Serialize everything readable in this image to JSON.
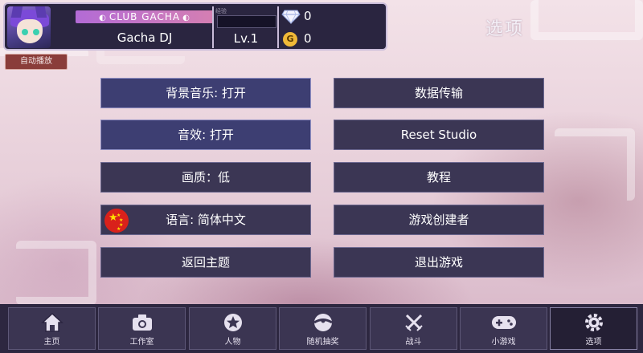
{
  "header": {
    "club_name": "CLUB GACHA",
    "player_name": "Gacha DJ",
    "level": "Lv.1",
    "xp_label": "经验",
    "gems": "0",
    "gold": "0",
    "gold_symbol": "G"
  },
  "page_title": "选项",
  "small_button": "自动播放",
  "menu": {
    "left": [
      {
        "label": "背景音乐: 打开",
        "state": "on"
      },
      {
        "label": "音效: 打开",
        "state": "on"
      },
      {
        "label": "画质：低"
      },
      {
        "label": "语言: 简体中文"
      },
      {
        "label": "返回主题"
      }
    ],
    "right": [
      {
        "label": "数据传输"
      },
      {
        "label": "Reset Studio"
      },
      {
        "label": "教程"
      },
      {
        "label": "游戏创建者"
      },
      {
        "label": "退出游戏"
      }
    ]
  },
  "nav": [
    {
      "label": "主页",
      "icon": "home-icon"
    },
    {
      "label": "工作室",
      "icon": "camera-icon"
    },
    {
      "label": "人物",
      "icon": "star-icon"
    },
    {
      "label": "随机抽奖",
      "icon": "gacha-ball-icon"
    },
    {
      "label": "战斗",
      "icon": "crossed-swords-icon"
    },
    {
      "label": "小游戏",
      "icon": "gamepad-icon"
    },
    {
      "label": "选项",
      "icon": "gear-icon",
      "active": true
    }
  ],
  "colors": {
    "panel": "#3b3654",
    "panel_active": "#3d3e72",
    "nav_bg": "#2d2740",
    "accent_pink": "#d57fb2",
    "gold": "#f0b938",
    "flag_red": "#d9211b"
  }
}
